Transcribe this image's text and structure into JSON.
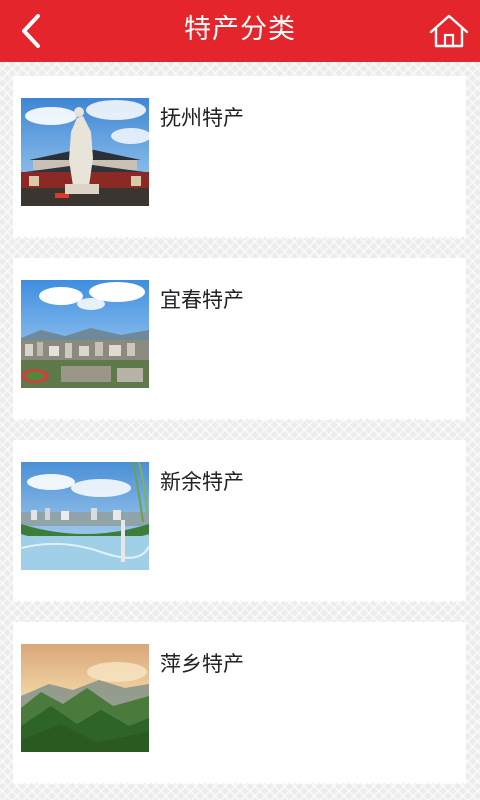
{
  "header": {
    "title": "特产分类",
    "back_icon": "chevron-left-icon",
    "home_icon": "home-icon",
    "color": "#e4252b"
  },
  "categories": [
    {
      "label": "抚州特产",
      "image": "statue-temple-photo"
    },
    {
      "label": "宜春特产",
      "image": "city-aerial-photo"
    },
    {
      "label": "新余特产",
      "image": "riverside-city-photo"
    },
    {
      "label": "萍乡特产",
      "image": "mountain-sunrise-photo"
    }
  ]
}
